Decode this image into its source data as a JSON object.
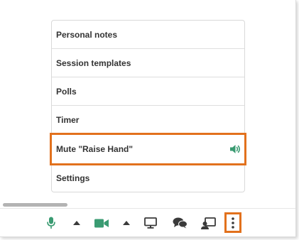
{
  "menu": {
    "items": [
      {
        "label": "Personal notes"
      },
      {
        "label": "Session templates"
      },
      {
        "label": "Polls"
      },
      {
        "label": "Timer"
      },
      {
        "label": "Mute \"Raise Hand\"",
        "icon": "speaker-icon",
        "highlighted": true
      },
      {
        "label": "Settings"
      }
    ]
  },
  "toolbar": {
    "icons": [
      "microphone-icon",
      "caret-up-icon",
      "video-camera-icon",
      "caret-up-icon",
      "monitor-icon",
      "chat-bubbles-icon",
      "screen-share-person-icon",
      "more-options-icon"
    ]
  },
  "colors": {
    "accent_green": "#3a9b72",
    "highlight_orange": "#e2711d",
    "icon_dark": "#3a3a3a",
    "text": "#333333"
  }
}
